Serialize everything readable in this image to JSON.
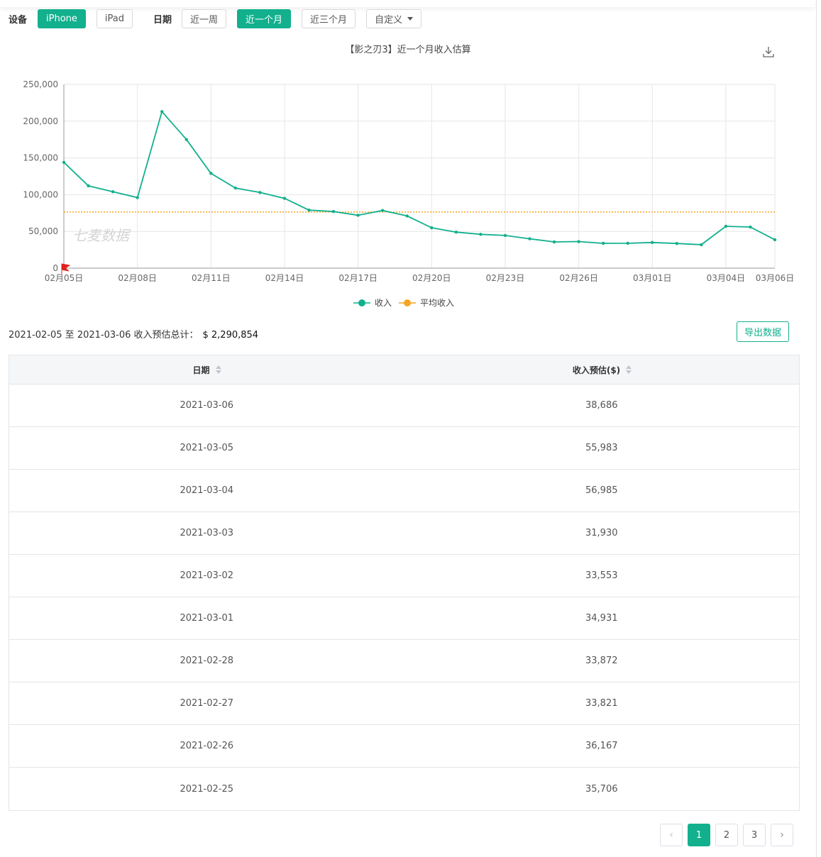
{
  "filters": {
    "device_label": "设备",
    "devices": [
      "iPhone",
      "iPad"
    ],
    "active_device": 0,
    "date_label": "日期",
    "ranges": [
      "近一周",
      "近一个月",
      "近三个月",
      "自定义"
    ],
    "active_range": 1
  },
  "chart_data": {
    "type": "line",
    "title": "【影之刃3】近一个月收入估算",
    "watermark": "七麦数据",
    "x": [
      "02-05",
      "02-06",
      "02-07",
      "02-08",
      "02-09",
      "02-10",
      "02-11",
      "02-12",
      "02-13",
      "02-14",
      "02-15",
      "02-16",
      "02-17",
      "02-18",
      "02-19",
      "02-20",
      "02-21",
      "02-22",
      "02-23",
      "02-24",
      "02-25",
      "02-26",
      "02-27",
      "02-28",
      "03-01",
      "03-02",
      "03-03",
      "03-04",
      "03-05",
      "03-06"
    ],
    "xtick_labels": [
      "02月05日",
      "02月08日",
      "02月11日",
      "02月14日",
      "02月17日",
      "02月20日",
      "02月23日",
      "02月26日",
      "03月01日",
      "03月04日",
      "03月06日"
    ],
    "xtick_index": [
      0,
      3,
      6,
      9,
      12,
      15,
      18,
      21,
      24,
      27,
      29
    ],
    "series": [
      {
        "name": "收入",
        "color": "#12b08d",
        "values": [
          144000,
          112000,
          104000,
          96000,
          213000,
          175000,
          129000,
          109000,
          103000,
          95000,
          79000,
          77000,
          72000,
          78500,
          71000,
          55000,
          49000,
          46000,
          44500,
          40000,
          35706,
          36167,
          33821,
          33872,
          34931,
          33553,
          31930,
          56985,
          55983,
          38686
        ]
      },
      {
        "name": "平均收入",
        "color": "#f5a623",
        "constant": 76362
      }
    ],
    "yticks": [
      0,
      50000,
      100000,
      150000,
      200000,
      250000
    ],
    "ytick_labels": [
      "0",
      "50,000",
      "100,000",
      "150,000",
      "200,000",
      "250,000"
    ],
    "ylim": [
      0,
      250000
    ],
    "grid": true,
    "legend_position": "bottom"
  },
  "summary": {
    "range_text": "2021-02-05 至 2021-03-06 收入预估总计：",
    "total": "$ 2,290,854"
  },
  "export_label": "导出数据",
  "table": {
    "headers": [
      "日期",
      "收入预估($)"
    ],
    "rows": [
      [
        "2021-03-06",
        "38,686"
      ],
      [
        "2021-03-05",
        "55,983"
      ],
      [
        "2021-03-04",
        "56,985"
      ],
      [
        "2021-03-03",
        "31,930"
      ],
      [
        "2021-03-02",
        "33,553"
      ],
      [
        "2021-03-01",
        "34,931"
      ],
      [
        "2021-02-28",
        "33,872"
      ],
      [
        "2021-02-27",
        "33,821"
      ],
      [
        "2021-02-26",
        "36,167"
      ],
      [
        "2021-02-25",
        "35,706"
      ]
    ]
  },
  "pagination": {
    "prev": "‹",
    "pages": [
      "1",
      "2",
      "3"
    ],
    "active": 0,
    "next": "›"
  },
  "icons": {
    "download": "download-icon",
    "flag": "flag-icon"
  }
}
